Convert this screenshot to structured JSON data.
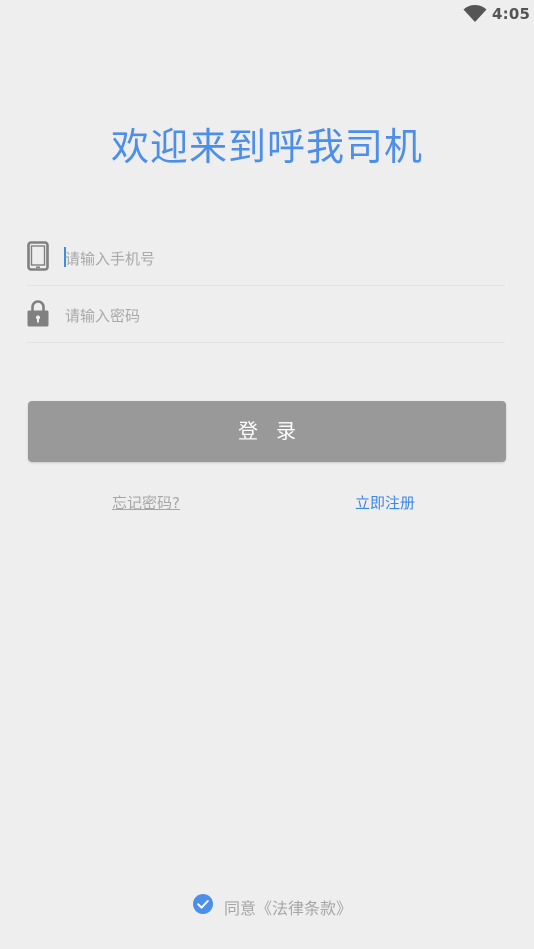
{
  "status_bar": {
    "time": "4:05",
    "wifi_icon": "wifi-icon"
  },
  "title": "欢迎来到呼我司机",
  "form": {
    "phone": {
      "icon": "mobile-phone-icon",
      "placeholder": "请输入手机号",
      "value": ""
    },
    "password": {
      "icon": "lock-icon",
      "placeholder": "请输入密码",
      "value": ""
    }
  },
  "login_button": {
    "label": "登录"
  },
  "links": {
    "forgot_password": "忘记密码?",
    "register": "立即注册"
  },
  "agreement": {
    "checked": true,
    "text": "同意《法律条款》",
    "check_icon": "check-circle-icon"
  },
  "colors": {
    "accent": "#4d8ee8",
    "background": "#eeeeee",
    "button_disabled": "#999999",
    "placeholder": "#a8a8a8"
  }
}
